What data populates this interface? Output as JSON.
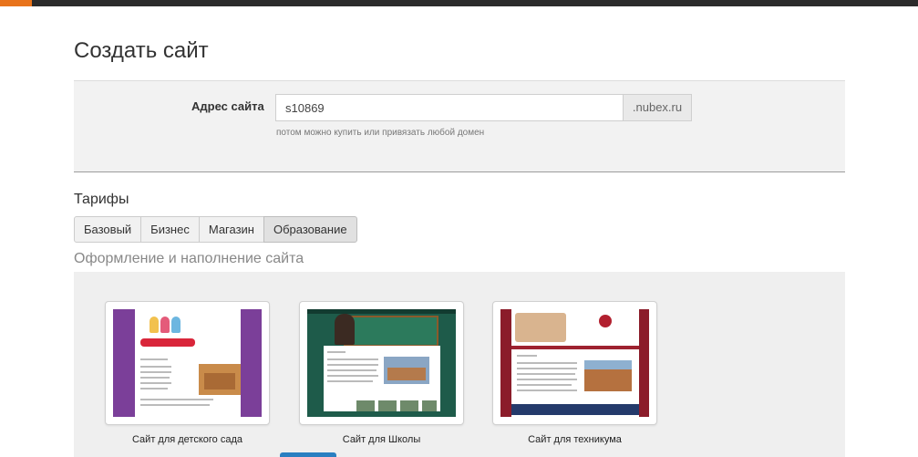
{
  "page": {
    "title": "Создать сайт"
  },
  "address": {
    "label": "Адрес сайта",
    "value": "s10869",
    "suffix": ".nubex.ru",
    "hint": "потом можно купить или привязать любой домен"
  },
  "tariffs": {
    "title": "Тарифы",
    "tabs": [
      {
        "label": "Базовый",
        "active": false
      },
      {
        "label": "Бизнес",
        "active": false
      },
      {
        "label": "Магазин",
        "active": false
      },
      {
        "label": "Образование",
        "active": true
      }
    ]
  },
  "design": {
    "title": "Оформление и наполнение сайта",
    "templates": [
      {
        "name": "Сайт для детского сада"
      },
      {
        "name": "Сайт для Школы"
      },
      {
        "name": "Сайт для техникума"
      }
    ]
  },
  "colors": {
    "accent": "#e8731b",
    "topbar": "#2b2b2b",
    "select_button": "#2a7fc1"
  }
}
